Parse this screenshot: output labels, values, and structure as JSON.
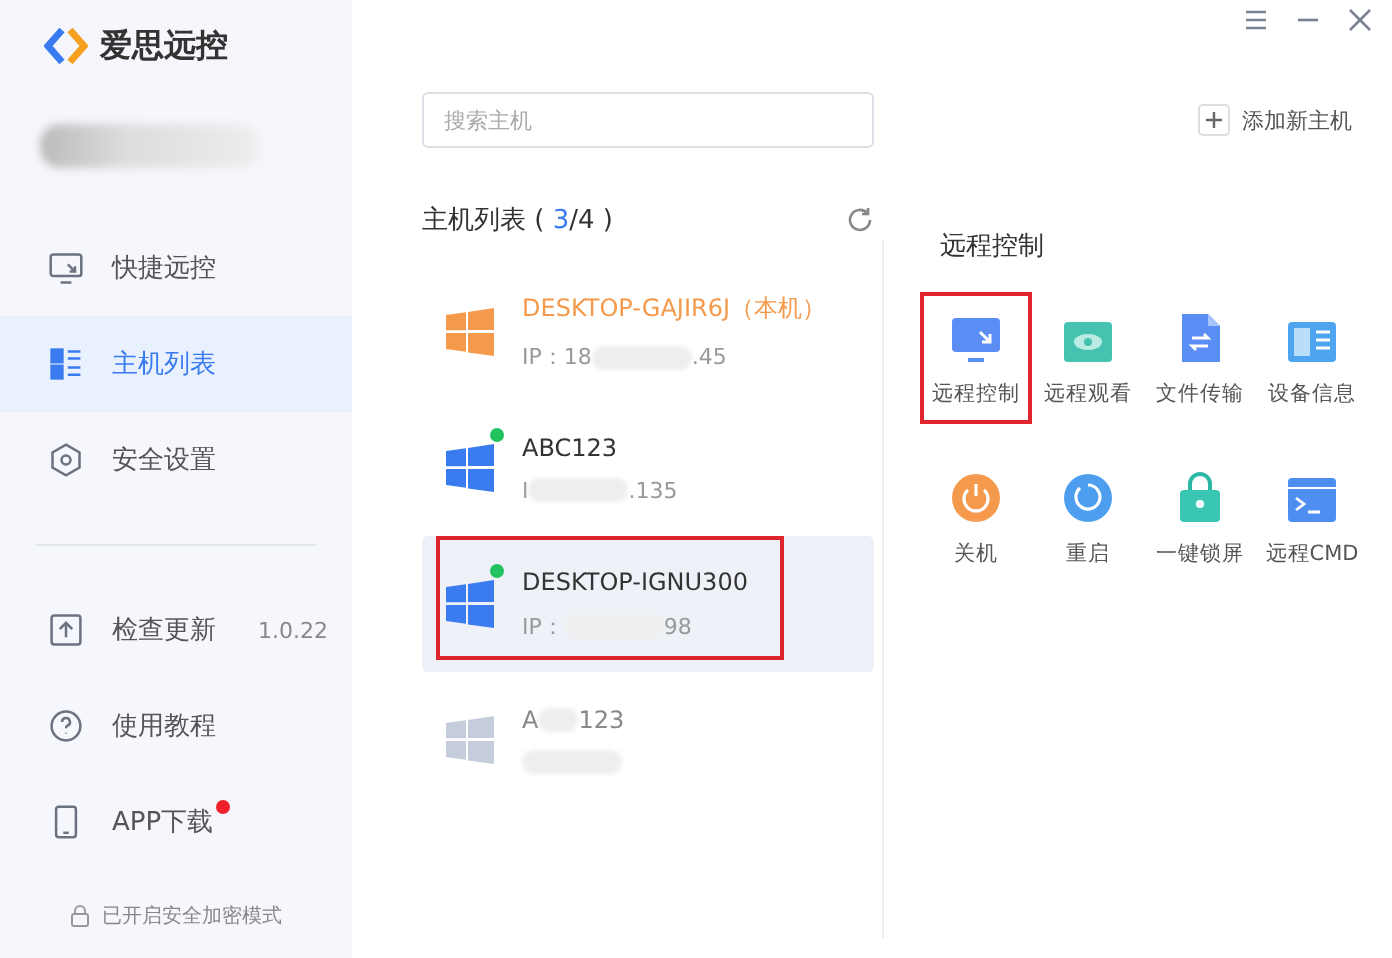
{
  "app": {
    "title": "爱思远控"
  },
  "window_controls": [
    {
      "kind": "menu"
    },
    {
      "kind": "minimize"
    },
    {
      "kind": "close"
    }
  ],
  "sidebar": {
    "items": [
      {
        "label": "快捷远控",
        "selected": false
      },
      {
        "label": "主机列表",
        "selected": true
      },
      {
        "label": "安全设置",
        "selected": false
      }
    ],
    "bottom_items": [
      {
        "label": "检查更新",
        "value": "1.0.22",
        "badge": false
      },
      {
        "label": "使用教程",
        "badge": false
      },
      {
        "label": "APP下载",
        "badge": true
      }
    ],
    "footer": "已开启安全加密模式"
  },
  "search": {
    "placeholder": "搜索主机"
  },
  "add_host": "添加新主机",
  "host_list": {
    "title": "主机列表 ( ",
    "online": "3",
    "total": "/4 )"
  },
  "hosts": [
    {
      "name": "DESKTOP-GAJIR6J（本机）",
      "ip_start": "IP：18",
      "ip_end": ".45",
      "kind": "local",
      "selected": false,
      "highlighted": false
    },
    {
      "name": "ABC123",
      "ip_start": "I",
      "ip_end": ".135",
      "kind": "online",
      "selected": false,
      "highlighted": false
    },
    {
      "name": "DESKTOP-IGNU300",
      "ip_start": "IP：",
      "ip_end": "98",
      "kind": "online",
      "selected": true,
      "highlighted": true
    },
    {
      "name": "A",
      "name_end": "123",
      "kind": "offline",
      "selected": false,
      "highlighted": false
    }
  ],
  "actions_title": "远程控制",
  "actions": [
    {
      "kind": "remote",
      "label": "远程控制",
      "highlighted": true
    },
    {
      "kind": "watch",
      "label": "远程观看",
      "highlighted": false
    },
    {
      "kind": "file",
      "label": "文件传输",
      "highlighted": false
    },
    {
      "kind": "info",
      "label": "设备信息",
      "highlighted": false
    },
    {
      "kind": "power",
      "label": "关机",
      "highlighted": false
    },
    {
      "kind": "restart",
      "label": "重启",
      "highlighted": false
    },
    {
      "kind": "lock",
      "label": "一键锁屏",
      "highlighted": false
    },
    {
      "kind": "cmd",
      "label": "远程CMD",
      "highlighted": false
    }
  ]
}
